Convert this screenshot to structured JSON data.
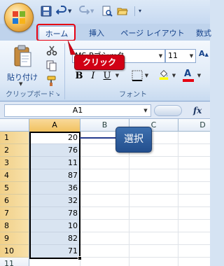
{
  "ribbon": {
    "tabs": [
      {
        "label": "ホーム",
        "active": true
      },
      {
        "label": "挿入",
        "active": false
      },
      {
        "label": "ページ レイアウト",
        "active": false
      },
      {
        "label": "数式",
        "active": false
      }
    ],
    "clipboard": {
      "paste_label": "貼り付け",
      "group_label": "クリップボード"
    },
    "font": {
      "font_name": "MS Pゴシック",
      "font_size": "11",
      "bold_label": "B",
      "italic_label": "I",
      "underline_label": "U",
      "group_label": "フォント",
      "font_color": "#e60012",
      "fill_color": "#ffff00"
    }
  },
  "annotations": {
    "click_label": "クリック",
    "select_label": "選択",
    "highlight_color": "#e60012"
  },
  "formula_bar": {
    "name_box": "A1",
    "fx_label": "fx"
  },
  "sheet": {
    "columns": [
      "A",
      "B",
      "C",
      "D"
    ],
    "rows": [
      "1",
      "2",
      "3",
      "4",
      "5",
      "6",
      "7",
      "8",
      "9",
      "10",
      "11"
    ],
    "column_a_values": [
      "20",
      "76",
      "11",
      "87",
      "36",
      "32",
      "78",
      "10",
      "82",
      "71"
    ]
  }
}
